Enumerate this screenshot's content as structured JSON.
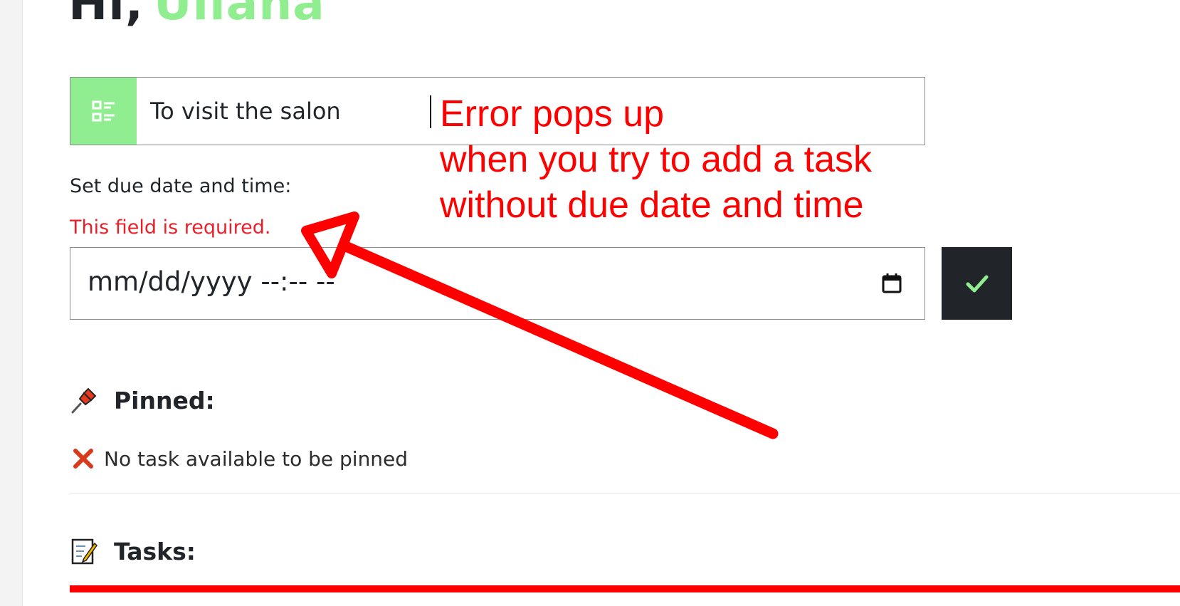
{
  "greeting": {
    "hi": "Hi,",
    "name": "Ullana"
  },
  "task_input": {
    "value": "To visit the salon"
  },
  "due_date": {
    "label": "Set due date and time:",
    "error": "This field is required.",
    "placeholder": "mm/dd/yyyy --:-- --"
  },
  "pinned": {
    "title": "Pinned:",
    "empty_message": "No task available to be pinned"
  },
  "tasks": {
    "title": "Tasks:"
  },
  "annotation": {
    "line1": "Error pops up",
    "line2": "when you try to add a task",
    "line3": "without due date and time"
  },
  "colors": {
    "accent_green": "#90ee90",
    "dark": "#212529",
    "error_red": "#e8202a",
    "annotation_red": "#ff0000"
  },
  "icons": {
    "task_icon": "list-icon",
    "calendar": "calendar-icon",
    "submit": "checkmark-icon",
    "pinned": "pushpin-icon",
    "empty": "cross-mark-icon",
    "tasks": "memo-icon"
  }
}
